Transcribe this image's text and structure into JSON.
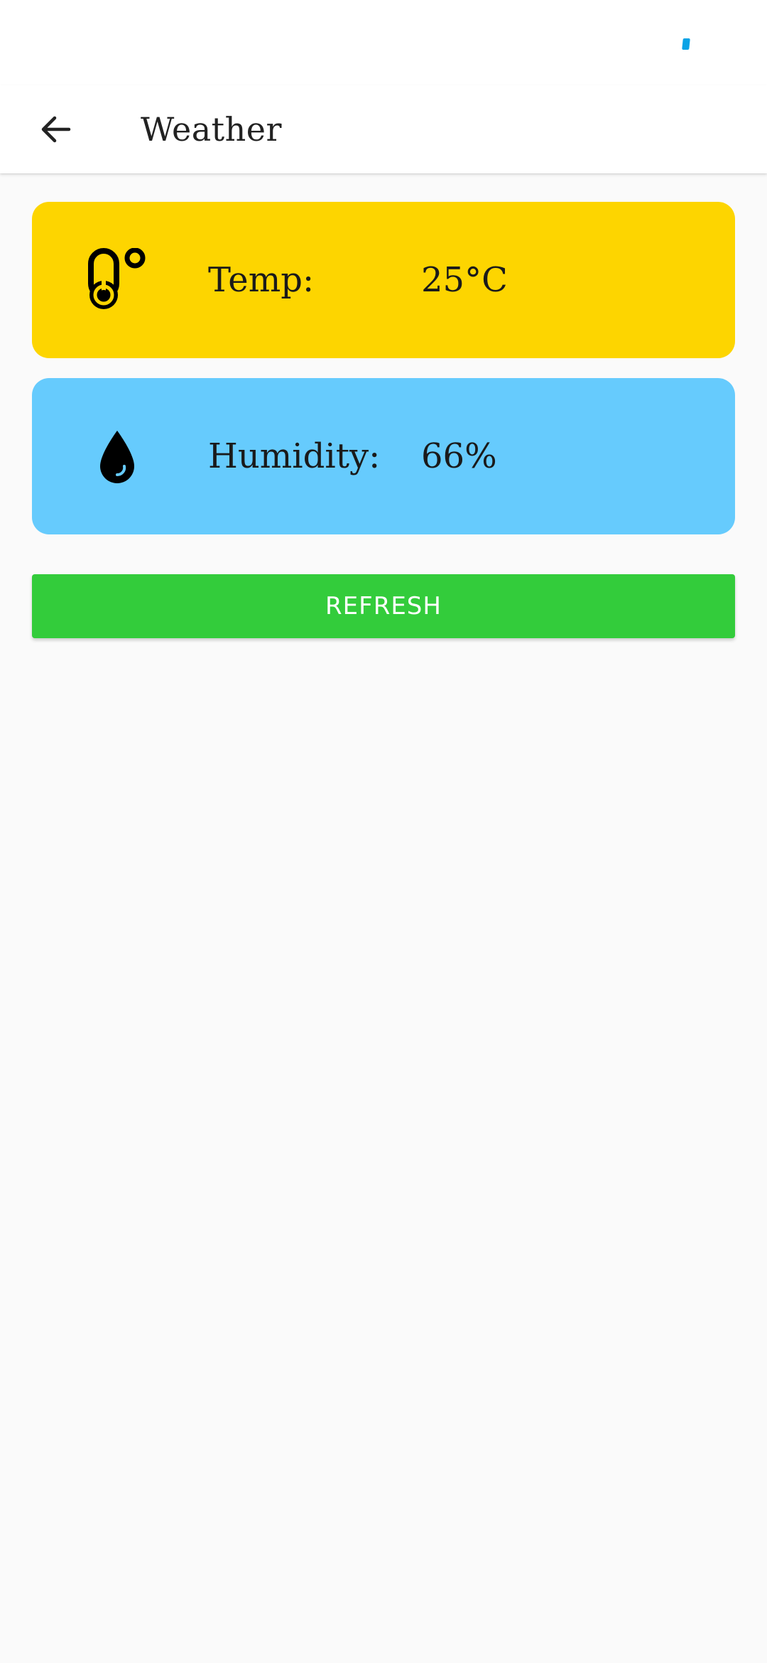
{
  "colors": {
    "status_dot": "#0aa3e6",
    "temp_card": "#fdd500",
    "humidity_card": "#66cbfd",
    "refresh_button": "#33cc3b"
  },
  "app_bar": {
    "title": "Weather",
    "back_icon": "arrow-back-icon"
  },
  "temperature": {
    "icon": "thermometer-icon",
    "label": "Temp:",
    "value": "25°C"
  },
  "humidity": {
    "icon": "water-drop-icon",
    "label": "Humidity:",
    "value": "66%"
  },
  "refresh": {
    "label": "REFRESH"
  }
}
